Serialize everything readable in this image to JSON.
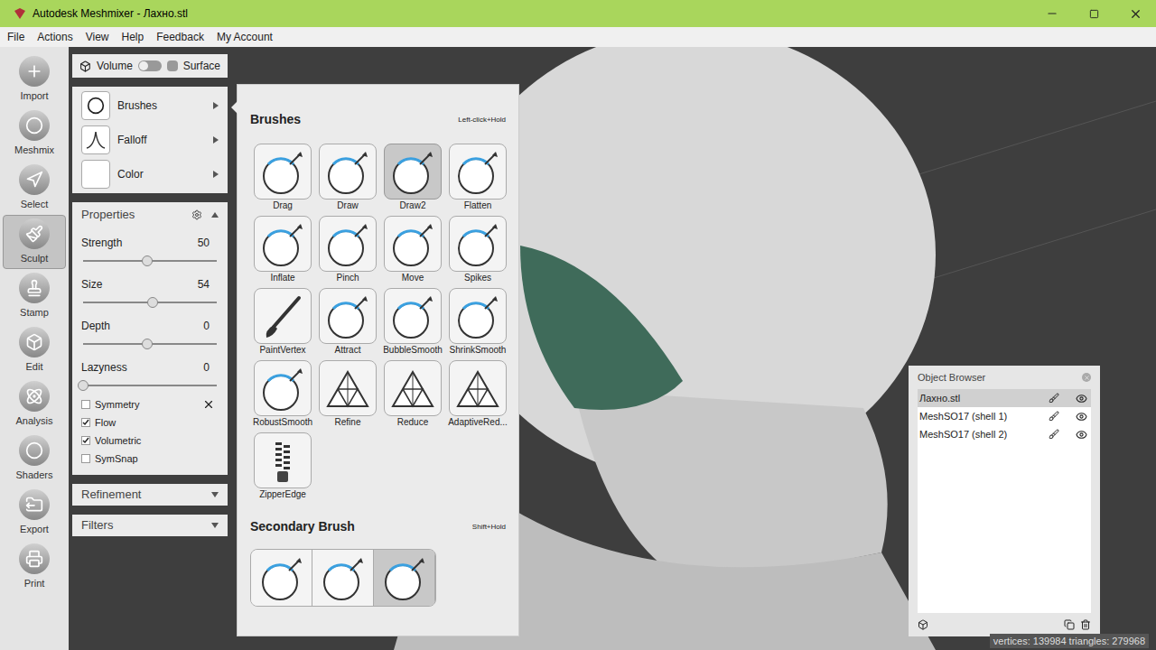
{
  "window": {
    "title": "Autodesk Meshmixer - Лахно.stl"
  },
  "menu": [
    "File",
    "Actions",
    "View",
    "Help",
    "Feedback",
    "My Account"
  ],
  "toolbar": [
    {
      "label": "Import",
      "selected": false
    },
    {
      "label": "Meshmix",
      "selected": false
    },
    {
      "label": "Select",
      "selected": false
    },
    {
      "label": "Sculpt",
      "selected": true
    },
    {
      "label": "Stamp",
      "selected": false
    },
    {
      "label": "Edit",
      "selected": false
    },
    {
      "label": "Analysis",
      "selected": false
    },
    {
      "label": "Shaders",
      "selected": false
    },
    {
      "label": "Export",
      "selected": false
    },
    {
      "label": "Print",
      "selected": false
    }
  ],
  "mode_toggle": {
    "left": "Volume",
    "right": "Surface",
    "on": false
  },
  "panel_rows": [
    {
      "label": "Brushes",
      "kind": "brush"
    },
    {
      "label": "Falloff",
      "kind": "falloff"
    },
    {
      "label": "Color",
      "kind": "color"
    }
  ],
  "properties": {
    "title": "Properties",
    "expanded": true,
    "sliders": [
      {
        "label": "Strength",
        "value": "50",
        "level": 0.48
      },
      {
        "label": "Size",
        "value": "54",
        "level": 0.52
      },
      {
        "label": "Depth",
        "value": "0",
        "level": 0.48
      },
      {
        "label": "Lazyness",
        "value": "0",
        "level": 0.0
      }
    ],
    "checkboxes": [
      {
        "label": "Symmetry",
        "checked": false
      },
      {
        "label": "Flow",
        "checked": true
      },
      {
        "label": "Volumetric",
        "checked": true
      },
      {
        "label": "SymSnap",
        "checked": false
      }
    ]
  },
  "sections": [
    {
      "label": "Refinement",
      "expanded": false
    },
    {
      "label": "Filters",
      "expanded": false
    }
  ],
  "brushes": {
    "title": "Brushes",
    "hint": "Left-click+Hold",
    "items": [
      {
        "label": "Drag",
        "kind": "sphere",
        "selected": false
      },
      {
        "label": "Draw",
        "kind": "sphere",
        "selected": false
      },
      {
        "label": "Draw2",
        "kind": "sphere",
        "selected": true
      },
      {
        "label": "Flatten",
        "kind": "sphere",
        "selected": false
      },
      {
        "label": "Inflate",
        "kind": "sphere",
        "selected": false
      },
      {
        "label": "Pinch",
        "kind": "sphere",
        "selected": false
      },
      {
        "label": "Move",
        "kind": "sphere",
        "selected": false
      },
      {
        "label": "Spikes",
        "kind": "sphere",
        "selected": false
      },
      {
        "label": "PaintVertex",
        "kind": "paint",
        "selected": false
      },
      {
        "label": "Attract",
        "kind": "sphere",
        "selected": false
      },
      {
        "label": "BubbleSmooth",
        "kind": "sphere",
        "selected": false
      },
      {
        "label": "ShrinkSmooth",
        "kind": "sphere",
        "selected": false
      },
      {
        "label": "RobustSmooth",
        "kind": "sphere",
        "selected": false
      },
      {
        "label": "Refine",
        "kind": "triangle",
        "selected": false
      },
      {
        "label": "Reduce",
        "kind": "triangle",
        "selected": false
      },
      {
        "label": "AdaptiveRed...",
        "kind": "triangle",
        "selected": false
      },
      {
        "label": "ZipperEdge",
        "kind": "zipper",
        "selected": false
      }
    ]
  },
  "secondary": {
    "title": "Secondary Brush",
    "hint": "Shift+Hold",
    "items": [
      {
        "selected": false
      },
      {
        "selected": false
      },
      {
        "selected": true
      }
    ]
  },
  "object_browser": {
    "title": "Object Browser",
    "items": [
      {
        "label": "Лахно.stl",
        "selected": true
      },
      {
        "label": "MeshSO17 (shell 1)",
        "selected": false
      },
      {
        "label": "MeshSO17 (shell 2)",
        "selected": false
      }
    ]
  },
  "status_bar": "vertices: 139984 triangles: 279968"
}
